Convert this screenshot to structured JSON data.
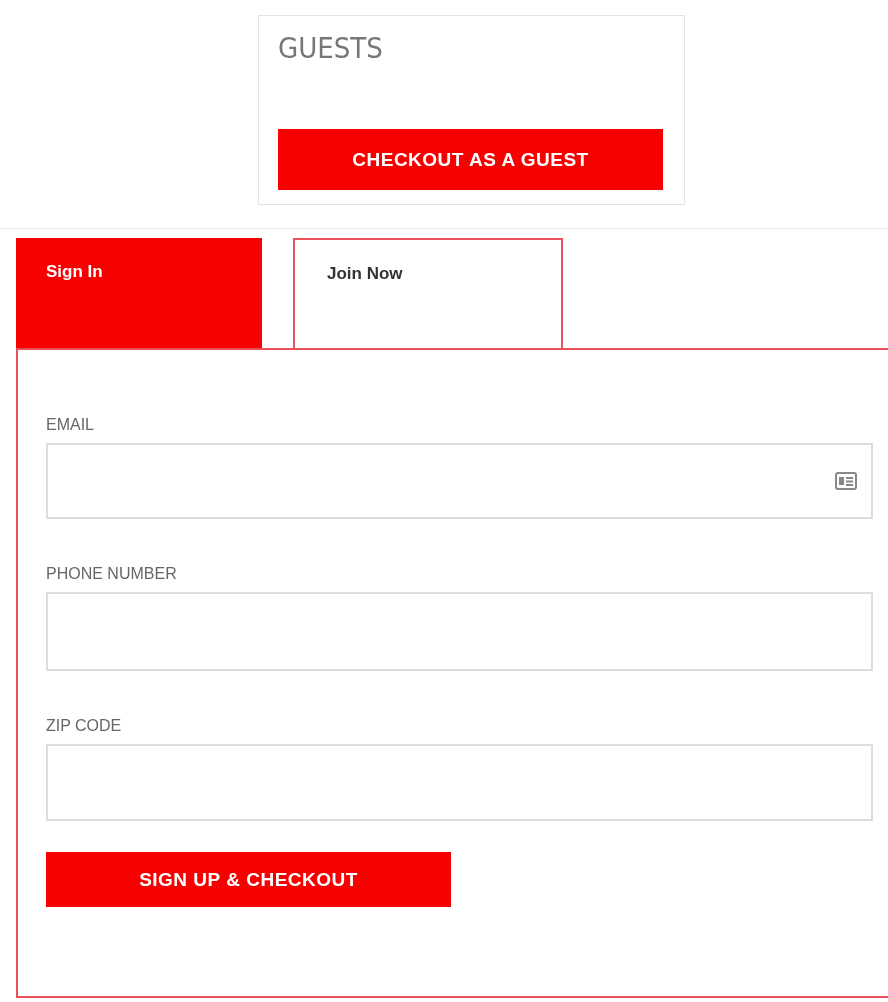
{
  "guests": {
    "title": "GUESTS",
    "button": "CHECKOUT AS A GUEST"
  },
  "tabs": [
    {
      "label": "Sign In",
      "selected": true
    },
    {
      "label": "Join Now",
      "selected": false
    }
  ],
  "form": {
    "fields": [
      {
        "label": "EMAIL",
        "kind": "contact"
      },
      {
        "label": "PHONE NUMBER",
        "kind": "plain"
      },
      {
        "label": "ZIP CODE",
        "kind": "plain"
      }
    ],
    "submit": "SIGN UP & CHECKOUT"
  }
}
